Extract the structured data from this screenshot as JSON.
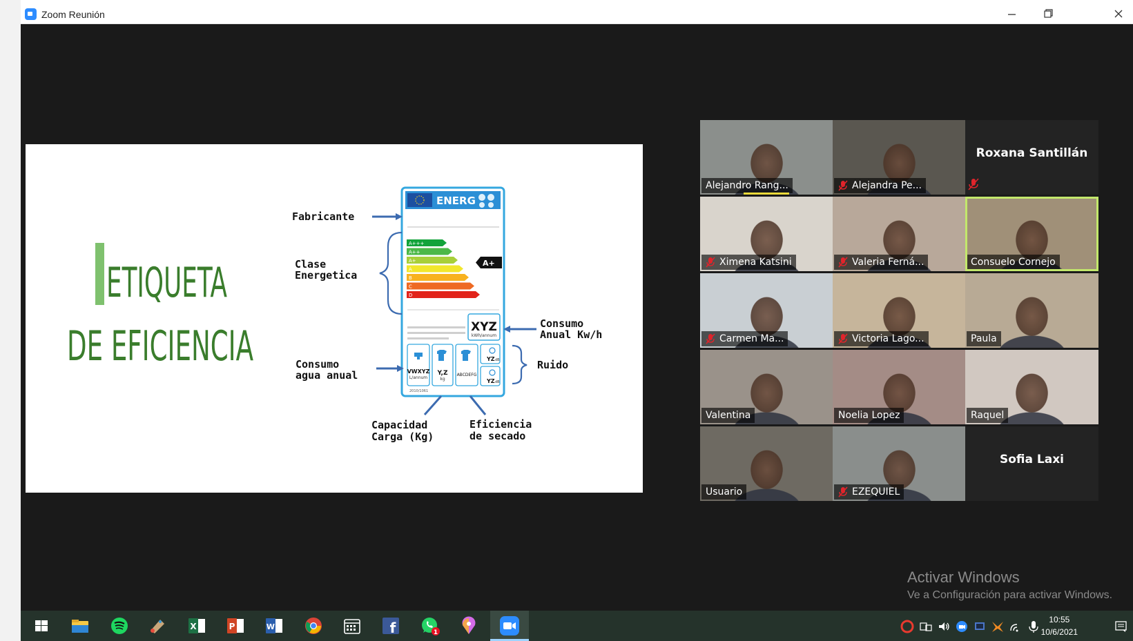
{
  "window": {
    "title": "Zoom Reunión",
    "minimize_icon": "minimize-icon",
    "restore_icon": "restore-icon",
    "close_icon": "close-icon"
  },
  "slide": {
    "title_line1": "ETIQUETA",
    "title_line2": "DE EFICIENCIA",
    "labels": {
      "fabricante": "Fabricante",
      "clase_line1": "Clase",
      "clase_line2": "Energetica",
      "consumo_anual_line1": "Consumo",
      "consumo_anual_line2": "Anual Kw/h",
      "ruido": "Ruido",
      "consumo_agua_line1": "Consumo",
      "consumo_agua_line2": "agua anual",
      "capacidad_line1": "Capacidad",
      "capacidad_line2": "Carga (Kg)",
      "eficiencia_line1": "Eficiencia",
      "eficiencia_line2": "de secado"
    },
    "energy_label": {
      "brand": "ENERG",
      "classes": [
        "A+++",
        "A++",
        "A+",
        "A",
        "B",
        "C",
        "D"
      ],
      "class_colors": [
        "#12a33a",
        "#4cb848",
        "#a8cf3a",
        "#f2e72c",
        "#f8b21f",
        "#ee6a23",
        "#e2231a"
      ],
      "indicator": "A+",
      "consumption": "XYZ",
      "consumption_unit": "kWh/annum",
      "water_value": "VWXYZ",
      "water_unit": "L/annum",
      "capacity_value": "Y,Z",
      "capacity_unit": "kg",
      "dry_class": "ABCDEFG",
      "noise_value": "YZ",
      "noise_unit": "dB",
      "regulation": "2010/1061"
    },
    "accent_color": "#3a7d2c",
    "bar_color": "#7fc16e",
    "arrow_color": "#3c6bb0"
  },
  "participants": [
    {
      "name": "Alejandro Rang...",
      "muted": false,
      "video": true,
      "speaking": false,
      "audio_level": true
    },
    {
      "name": "Alejandra Pe...",
      "muted": true,
      "video": true,
      "speaking": false,
      "audio_level": false
    },
    {
      "name": "Roxana Santillán",
      "muted": true,
      "video": false,
      "speaking": false,
      "audio_level": false
    },
    {
      "name": "Ximena Katsini",
      "muted": true,
      "video": true,
      "speaking": false,
      "audio_level": false
    },
    {
      "name": "Valeria Ferná...",
      "muted": true,
      "video": true,
      "speaking": false,
      "audio_level": false
    },
    {
      "name": "Consuelo Cornejo",
      "muted": false,
      "video": true,
      "speaking": true,
      "audio_level": false
    },
    {
      "name": "Carmen Ma...",
      "muted": true,
      "video": true,
      "speaking": false,
      "audio_level": false
    },
    {
      "name": "Victoria Lago...",
      "muted": true,
      "video": true,
      "speaking": false,
      "audio_level": false
    },
    {
      "name": "Paula",
      "muted": false,
      "video": true,
      "speaking": false,
      "audio_level": false
    },
    {
      "name": "Valentina",
      "muted": false,
      "video": true,
      "speaking": false,
      "audio_level": false
    },
    {
      "name": "Noelia Lopez",
      "muted": false,
      "video": true,
      "speaking": false,
      "audio_level": false
    },
    {
      "name": "Raquel",
      "muted": false,
      "video": true,
      "speaking": false,
      "audio_level": false
    },
    {
      "name": "Usuario",
      "muted": false,
      "video": true,
      "speaking": false,
      "audio_level": false
    },
    {
      "name": "EZEQUIEL",
      "muted": true,
      "video": true,
      "speaking": false,
      "audio_level": false
    },
    {
      "name": "Sofia Laxi",
      "muted": false,
      "video": false,
      "speaking": false,
      "audio_level": false
    }
  ],
  "watermark": {
    "title": "Activar Windows",
    "subtitle": "Ve a Configuración para activar Windows."
  },
  "taskbar": {
    "apps": [
      "windows-start-icon",
      "file-explorer-icon",
      "spotify-icon",
      "paint-icon",
      "excel-icon",
      "powerpoint-icon",
      "word-icon",
      "chrome-icon",
      "calendar-icon",
      "facebook-icon",
      "whatsapp-icon",
      "maps-pin-icon",
      "zoom-icon"
    ],
    "excel_letter": "X",
    "powerpoint_letter": "P",
    "word_letter": "W",
    "facebook_letter": "f",
    "whatsapp_badge": "1",
    "time": "10:55",
    "date": "10/6/2021"
  }
}
